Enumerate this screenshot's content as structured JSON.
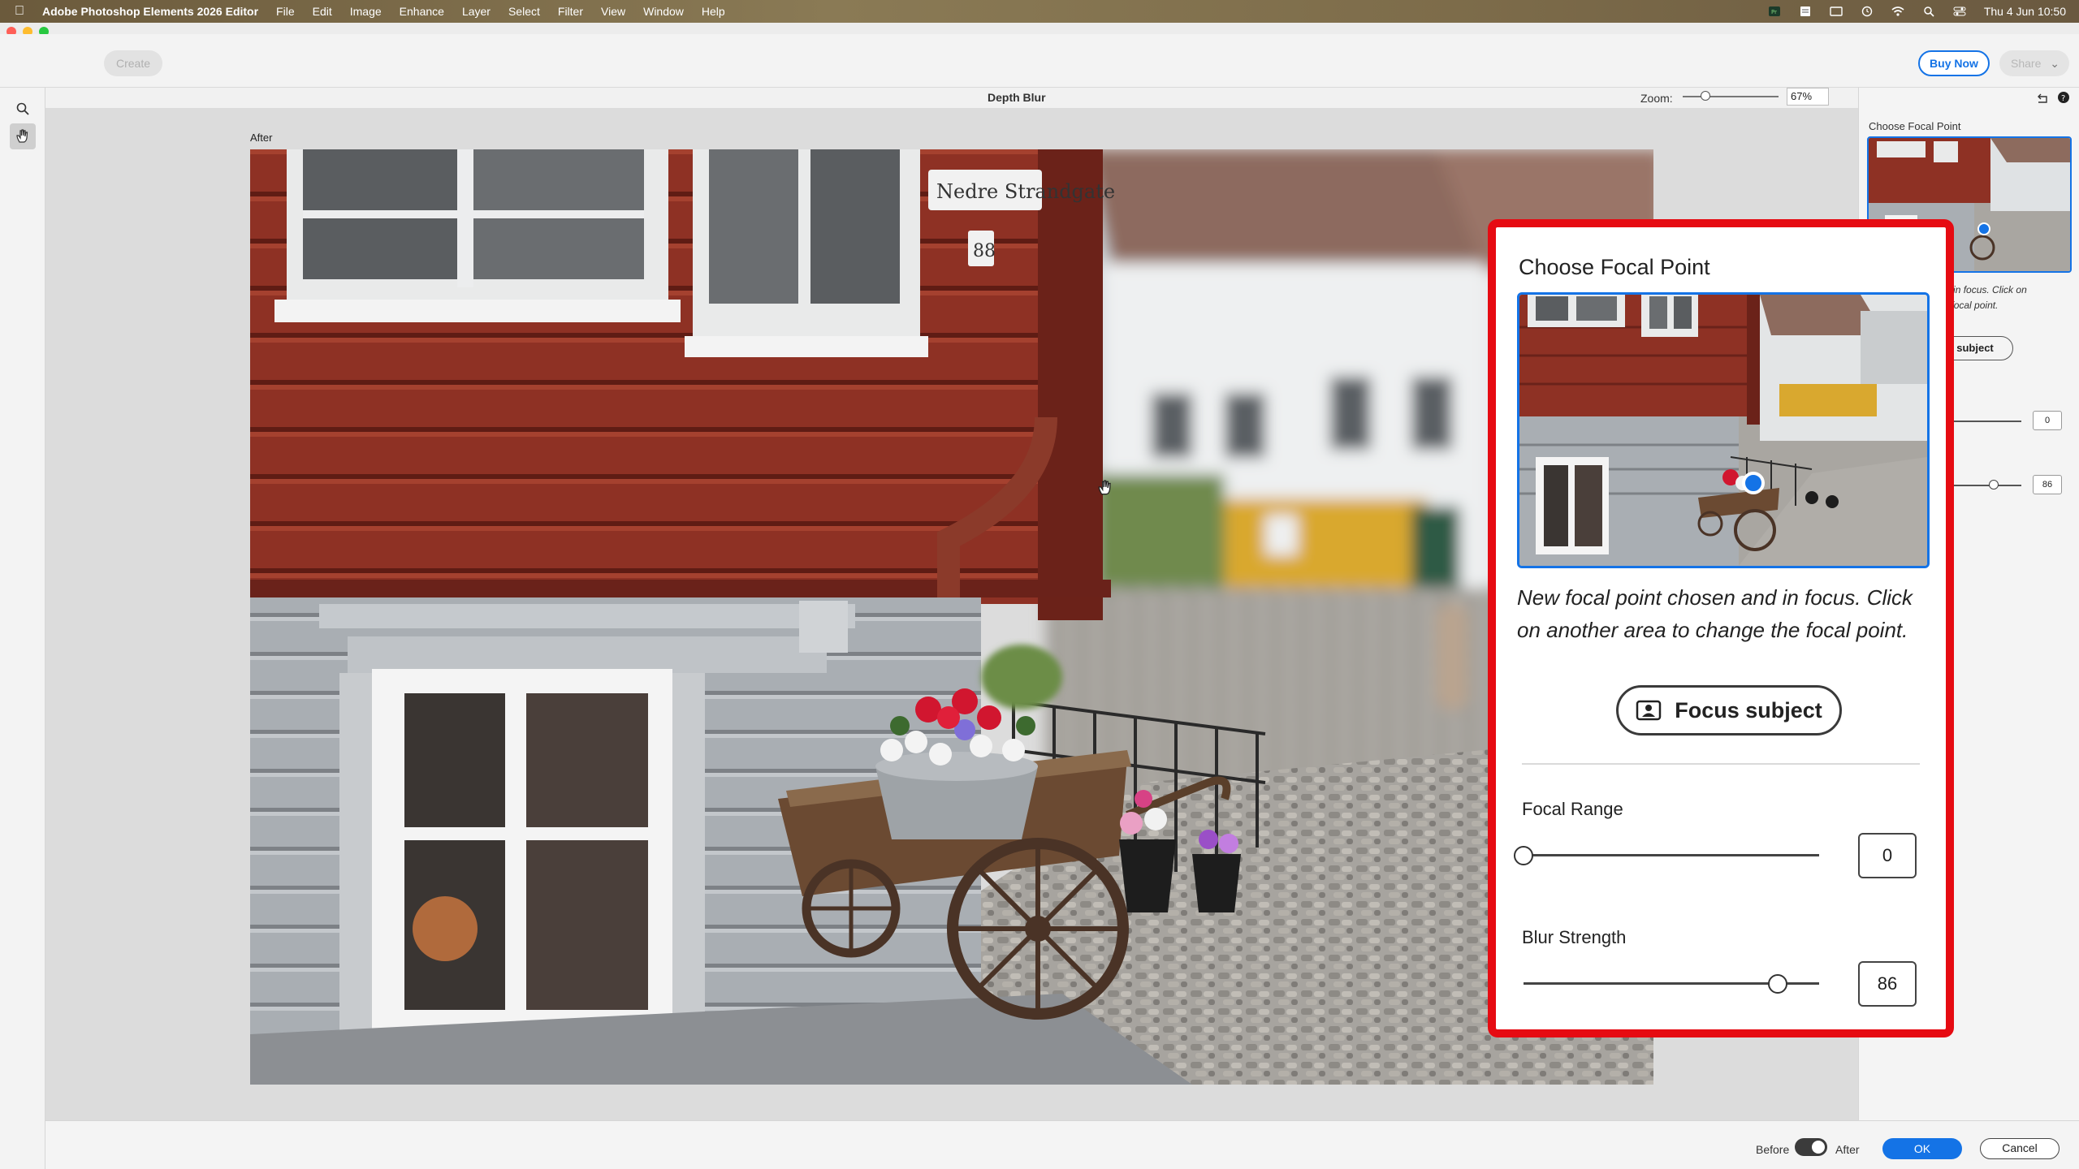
{
  "menubar": {
    "app_name": "Adobe Photoshop Elements 2026 Editor",
    "menus": [
      "File",
      "Edit",
      "Image",
      "Enhance",
      "Layer",
      "Select",
      "Filter",
      "View",
      "Window",
      "Help"
    ],
    "clock": "Thu 4 Jun  10:50",
    "status_icons": [
      "menu-app-icon",
      "document-icon",
      "display-icon",
      "time-machine-icon",
      "wifi-icon",
      "spotlight-search-icon",
      "control-center-icon"
    ]
  },
  "toolbar": {
    "create_label": "Create",
    "buy_now_label": "Buy Now",
    "share_label": "Share"
  },
  "tools": [
    "zoom-tool-icon",
    "hand-tool-icon"
  ],
  "canvas": {
    "title": "Depth Blur",
    "zoom_label": "Zoom:",
    "zoom_value": "67%",
    "view_label": "After"
  },
  "right_panel": {
    "title": "Choose Focal Point",
    "hint_fragment": "…sen and in focus. Click on …nge the focal point.",
    "hint_line1": "sen and in focus. Click on",
    "hint_line2": "nge the focal point.",
    "focus_fragment": "cus subject",
    "focal_range_value": "0",
    "blur_strength_value": "86"
  },
  "callout": {
    "title": "Choose Focal Point",
    "description": "New focal point chosen and in focus. Click on another area to change the focal point.",
    "focus_subject_label": "Focus subject",
    "focal_range": {
      "label": "Focal Range",
      "value": "0",
      "level": 0
    },
    "blur_strength": {
      "label": "Blur Strength",
      "value": "86",
      "level": 0.86
    },
    "highlight_color": "#e60b12"
  },
  "bottombar": {
    "before_label": "Before",
    "after_label": "After",
    "ok_label": "OK",
    "cancel_label": "Cancel"
  },
  "colors": {
    "accent": "#1473e6",
    "house_red": "#8b2e22",
    "house_grey": "#a9aeb3"
  }
}
